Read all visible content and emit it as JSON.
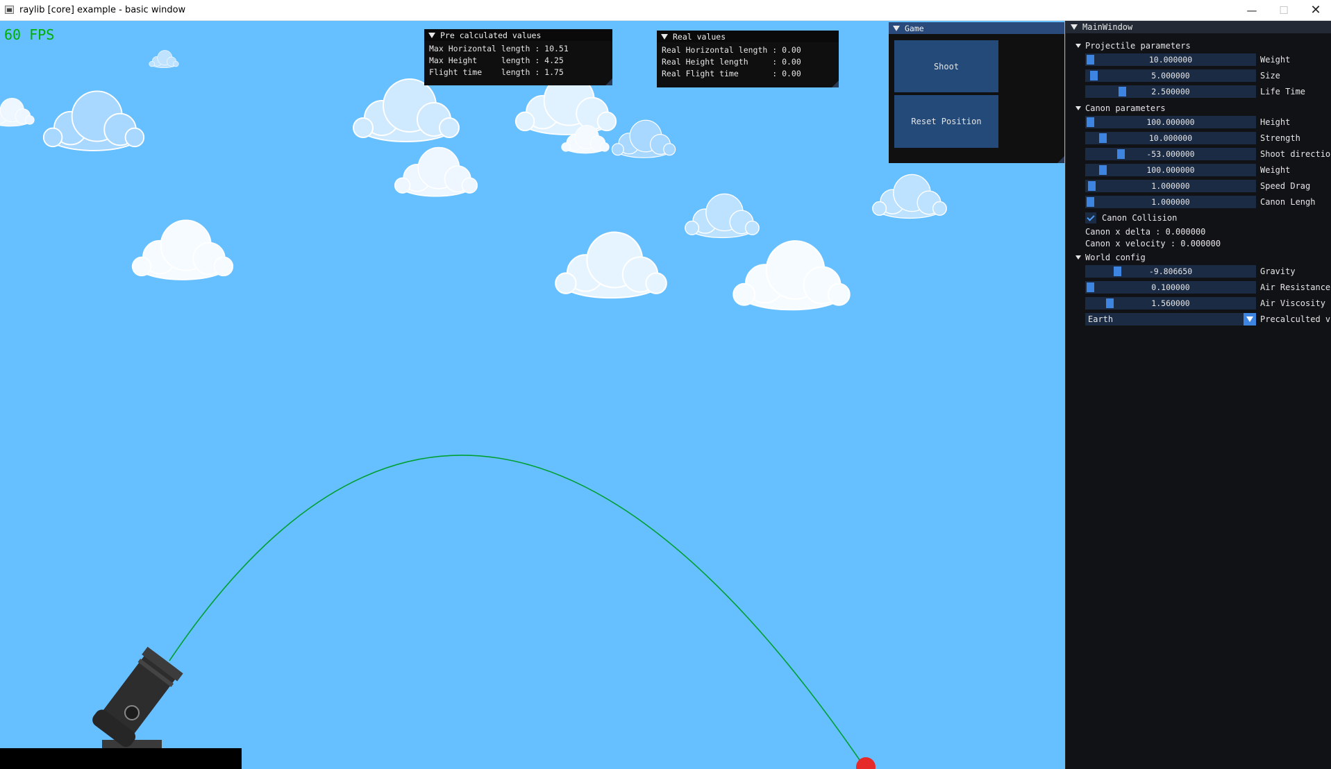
{
  "window": {
    "title": "raylib [core] example - basic window",
    "minimize_glyph": "—",
    "maximize_glyph": "☐",
    "close_glyph": "✕"
  },
  "hud": {
    "fps": "60 FPS"
  },
  "precalc": {
    "title": "Pre calculated values",
    "rows": [
      "Max Horizontal length : 10.51",
      "Max Height     length : 4.25",
      "Flight time    length : 1.75"
    ]
  },
  "real": {
    "title": "Real values",
    "rows": [
      "Real Horizontal length : 0.00",
      "Real Height length     : 0.00",
      "Real Flight time       : 0.00"
    ]
  },
  "game_window": {
    "title": "Game",
    "shoot_label": "Shoot",
    "reset_label": "Reset Position"
  },
  "main_window": {
    "title": "MainWindow",
    "projectile": {
      "header": "Projectile parameters",
      "sliders": [
        {
          "value": "10.000000",
          "label": "Weight",
          "fraction": 0.0
        },
        {
          "value": "5.000000",
          "label": "Size",
          "fraction": 0.02
        },
        {
          "value": "2.500000",
          "label": "Life Time",
          "fraction": 0.2
        }
      ]
    },
    "canon": {
      "header": "Canon parameters",
      "sliders": [
        {
          "value": "100.000000",
          "label": "Height",
          "fraction": 0.0
        },
        {
          "value": "10.000000",
          "label": "Strength",
          "fraction": 0.08
        },
        {
          "value": "-53.000000",
          "label": "Shoot directio",
          "fraction": 0.19
        },
        {
          "value": "100.000000",
          "label": "Weight",
          "fraction": 0.08
        },
        {
          "value": "1.000000",
          "label": "Speed Drag",
          "fraction": 0.01
        },
        {
          "value": "1.000000",
          "label": "Canon Lengh",
          "fraction": 0.0
        }
      ],
      "collision_label": "Canon Collision",
      "collision_checked": true,
      "x_delta": "Canon x delta : 0.000000",
      "x_velocity": "Canon x velocity : 0.000000"
    },
    "world": {
      "header": "World config",
      "sliders": [
        {
          "value": "-9.806650",
          "label": "Gravity",
          "fraction": 0.17
        },
        {
          "value": "0.100000",
          "label": "Air Resistance",
          "fraction": 0.0
        },
        {
          "value": "1.560000",
          "label": "Air Viscosity",
          "fraction": 0.12
        }
      ],
      "preset_value": "Earth",
      "preset_label": "Precalculted v"
    }
  },
  "colors": {
    "sky": "#66bfff",
    "trajectory": "#00a030",
    "projectile": "#e62929",
    "slider_bg": "#1b2b44",
    "slider_knob": "#3d85e0",
    "button": "#234a78"
  }
}
